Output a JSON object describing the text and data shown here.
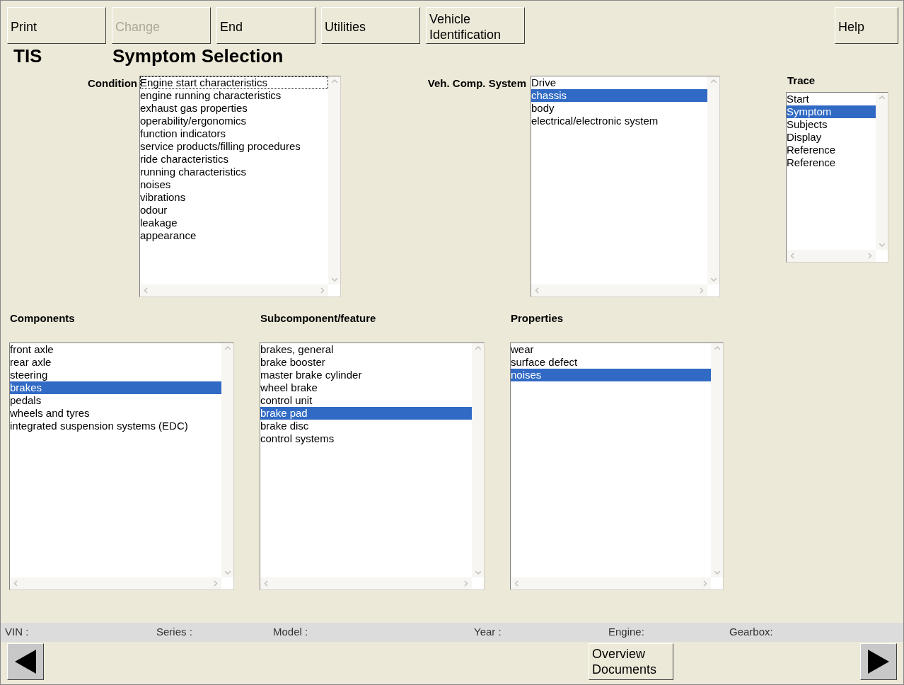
{
  "toolbar": [
    {
      "label": "Print",
      "disabled": false
    },
    {
      "label": "Change",
      "disabled": true
    },
    {
      "label": "End",
      "disabled": false
    },
    {
      "label": "Utilities",
      "disabled": false
    },
    {
      "label": "Vehicle Identification",
      "disabled": false
    }
  ],
  "help_button": {
    "label": "Help",
    "disabled": false
  },
  "app_name": "TIS",
  "page_title": "Symptom Selection",
  "condition": {
    "label": "Condition",
    "items": [
      {
        "label": "Engine start characteristics",
        "selected": false,
        "focused": true
      },
      {
        "label": "engine running characteristics",
        "selected": false,
        "focused": false
      },
      {
        "label": "exhaust gas properties",
        "selected": false,
        "focused": false
      },
      {
        "label": "operability/ergonomics",
        "selected": false,
        "focused": false
      },
      {
        "label": "function indicators",
        "selected": false,
        "focused": false
      },
      {
        "label": "service products/filling procedures",
        "selected": false,
        "focused": false
      },
      {
        "label": "ride characteristics",
        "selected": false,
        "focused": false
      },
      {
        "label": "running characteristics",
        "selected": false,
        "focused": false
      },
      {
        "label": "noises",
        "selected": false,
        "focused": false
      },
      {
        "label": "vibrations",
        "selected": false,
        "focused": false
      },
      {
        "label": "odour",
        "selected": false,
        "focused": false
      },
      {
        "label": "leakage",
        "selected": false,
        "focused": false
      },
      {
        "label": "appearance",
        "selected": false,
        "focused": false
      }
    ]
  },
  "vehicle_component_system": {
    "label": "Veh. Comp. System",
    "items": [
      {
        "label": "Drive",
        "selected": false
      },
      {
        "label": "chassis",
        "selected": true
      },
      {
        "label": "body",
        "selected": false
      },
      {
        "label": "electrical/electronic system",
        "selected": false
      }
    ]
  },
  "trace": {
    "label": "Trace",
    "items": [
      {
        "label": "Start",
        "selected": false
      },
      {
        "label": "Symptom",
        "selected": true
      },
      {
        "label": "Subjects",
        "selected": false
      },
      {
        "label": "Display",
        "selected": false
      },
      {
        "label": "Reference",
        "selected": false
      },
      {
        "label": "Reference",
        "selected": false
      }
    ]
  },
  "components": {
    "label": "Components",
    "items": [
      {
        "label": "front axle",
        "selected": false
      },
      {
        "label": "rear axle",
        "selected": false
      },
      {
        "label": "steering",
        "selected": false
      },
      {
        "label": "brakes",
        "selected": true
      },
      {
        "label": "pedals",
        "selected": false
      },
      {
        "label": "wheels and tyres",
        "selected": false
      },
      {
        "label": "integrated suspension systems (EDC)",
        "selected": false
      }
    ]
  },
  "subcomponent": {
    "label": "Subcomponent/feature",
    "items": [
      {
        "label": "brakes, general",
        "selected": false
      },
      {
        "label": "brake booster",
        "selected": false
      },
      {
        "label": "master brake cylinder",
        "selected": false
      },
      {
        "label": "wheel brake",
        "selected": false
      },
      {
        "label": "control unit",
        "selected": false
      },
      {
        "label": "brake pad",
        "selected": true
      },
      {
        "label": "brake disc",
        "selected": false
      },
      {
        "label": "control systems",
        "selected": false
      }
    ]
  },
  "properties": {
    "label": "Properties",
    "items": [
      {
        "label": "wear",
        "selected": false
      },
      {
        "label": "surface defect",
        "selected": false
      },
      {
        "label": "noises",
        "selected": true
      }
    ]
  },
  "status_bar": [
    "VIN :",
    "Series :",
    "Model :",
    "Year :",
    "Engine:",
    "Gearbox:"
  ],
  "overview_button": {
    "label": "Overview Documents"
  }
}
